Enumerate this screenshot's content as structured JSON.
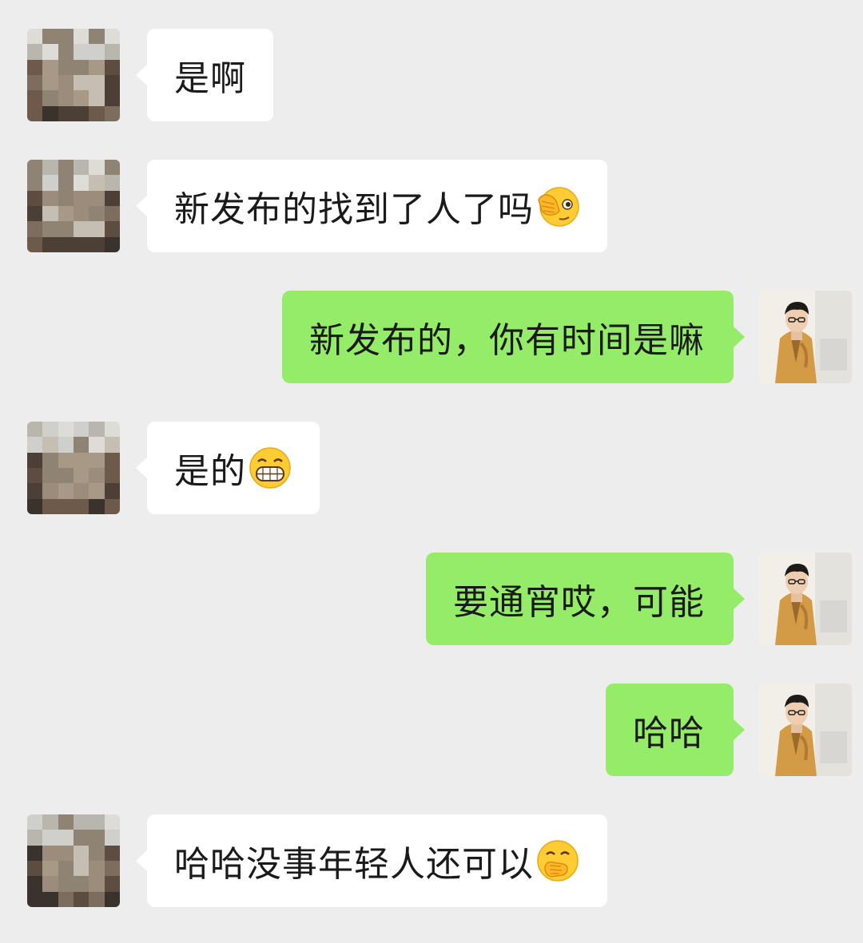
{
  "messages": [
    {
      "side": "in",
      "text": "是啊",
      "emoji": null
    },
    {
      "side": "in",
      "text": "新发布的找到了人了吗",
      "emoji": "facepalm-peek-emoji"
    },
    {
      "side": "out",
      "text": "新发布的，你有时间是嘛",
      "emoji": null
    },
    {
      "side": "in",
      "text": "是的",
      "emoji": "grin-emoji"
    },
    {
      "side": "out",
      "text": "要通宵哎，可能",
      "emoji": null
    },
    {
      "side": "out",
      "text": "哈哈",
      "emoji": null
    },
    {
      "side": "in",
      "text": "哈哈没事年轻人还可以",
      "emoji": "hand-over-mouth-emoji"
    }
  ],
  "colors": {
    "background": "#ededed",
    "incoming_bubble": "#ffffff",
    "outgoing_bubble": "#95ec69",
    "text": "#1a1a1a"
  },
  "avatars": {
    "incoming": "pixelated-contact-avatar",
    "outgoing": "man-in-camel-coat-avatar"
  }
}
